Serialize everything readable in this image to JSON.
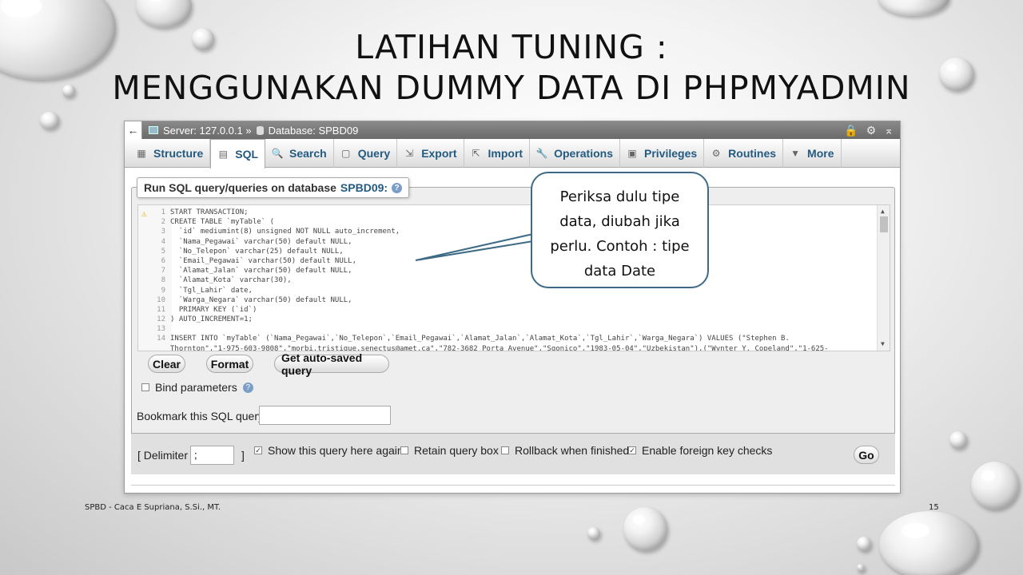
{
  "slide": {
    "title_line1": "LATIHAN TUNING :",
    "title_line2": "MENGGUNAKAN DUMMY DATA DI PHPMYADMIN",
    "footer_left": "SPBD - Caca E Supriana, S.Si., MT.",
    "page_number": "15"
  },
  "topbar": {
    "back": "←",
    "server": "Server: 127.0.0.1 »",
    "database": "Database: SPBD09",
    "icons": [
      "lock-icon",
      "gear-icon",
      "collapse-icon"
    ]
  },
  "tabs": [
    {
      "label": "Structure",
      "icon": "structure-icon"
    },
    {
      "label": "SQL",
      "icon": "sql-icon"
    },
    {
      "label": "Search",
      "icon": "search-icon"
    },
    {
      "label": "Query",
      "icon": "query-icon"
    },
    {
      "label": "Export",
      "icon": "export-icon"
    },
    {
      "label": "Import",
      "icon": "import-icon"
    },
    {
      "label": "Operations",
      "icon": "wrench-icon"
    },
    {
      "label": "Privileges",
      "icon": "privileges-icon"
    },
    {
      "label": "Routines",
      "icon": "routines-icon"
    },
    {
      "label": "More",
      "icon": "triangle-down-icon"
    }
  ],
  "panel": {
    "legend_prefix": "Run SQL query/queries on database",
    "legend_db": "SPBD09:",
    "help": "?"
  },
  "editor": {
    "lines": [
      {
        "n": "1",
        "t": "START TRANSACTION;"
      },
      {
        "n": "2",
        "t": "CREATE TABLE `myTable` ("
      },
      {
        "n": "3",
        "t": "  `id` mediumint(8) unsigned NOT NULL auto_increment,"
      },
      {
        "n": "4",
        "t": "  `Nama_Pegawai` varchar(50) default NULL,"
      },
      {
        "n": "5",
        "t": "  `No_Telepon` varchar(25) default NULL,"
      },
      {
        "n": "6",
        "t": "  `Email_Pegawai` varchar(50) default NULL,"
      },
      {
        "n": "7",
        "t": "  `Alamat_Jalan` varchar(50) default NULL,"
      },
      {
        "n": "8",
        "t": "  `Alamat_Kota` varchar(30),"
      },
      {
        "n": "9",
        "t": "  `Tgl_Lahir` date,"
      },
      {
        "n": "10",
        "t": "  `Warga_Negara` varchar(50) default NULL,"
      },
      {
        "n": "11",
        "t": "  PRIMARY KEY (`id`)"
      },
      {
        "n": "12",
        "t": ") AUTO_INCREMENT=1;"
      },
      {
        "n": "13",
        "t": ""
      },
      {
        "n": "14",
        "t": "INSERT INTO `myTable` (`Nama_Pegawai`,`No_Telepon`,`Email_Pegawai`,`Alamat_Jalan`,`Alamat_Kota`,`Tgl_Lahir`,`Warga_Negara`) VALUES (\"Stephen B."
      },
      {
        "n": "",
        "t": "Thornton\",\"1-975-603-9808\",\"morbi.tristique.senectus@amet.ca\",\"782-3682 Porta Avenue\",\"Sgonico\",\"1983-05-04\",\"Uzbekistan\"),(\"Wynter Y. Copeland\",\"1-625-"
      }
    ]
  },
  "buttons": {
    "clear": "Clear",
    "format": "Format",
    "autosaved": "Get auto-saved query",
    "go": "Go"
  },
  "bind_parameters": {
    "label": "Bind parameters",
    "checked": false
  },
  "bookmark": {
    "label": "Bookmark this SQL query:",
    "value": ""
  },
  "options": {
    "delimiter_open": "[ Delimiter",
    "delimiter_value": ";",
    "delimiter_close": "]",
    "show_query": {
      "label": "Show this query here again",
      "checked": true
    },
    "retain": {
      "label": "Retain query box",
      "checked": false
    },
    "rollback": {
      "label": "Rollback when finished",
      "checked": false
    },
    "fk_checks": {
      "label": "Enable foreign key checks",
      "checked": true
    }
  },
  "callout": {
    "lines": [
      "Periksa dulu tipe",
      "data, diubah jika",
      "perlu. Contoh : tipe",
      "data Date"
    ]
  }
}
